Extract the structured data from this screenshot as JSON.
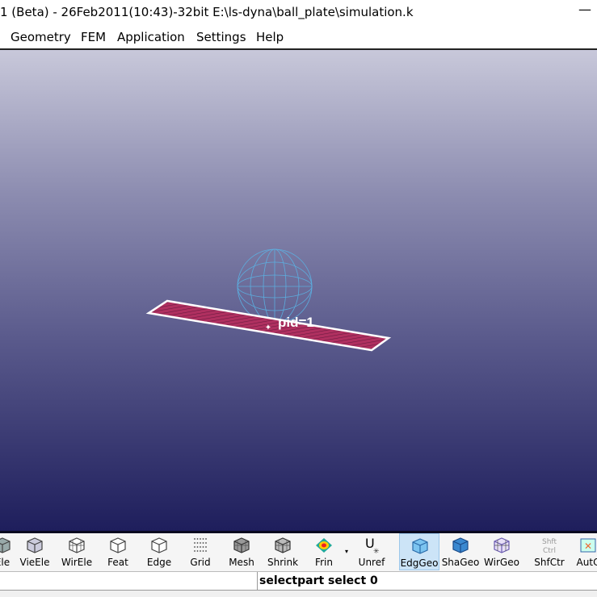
{
  "window": {
    "title": "1 (Beta) - 26Feb2011(10:43)-32bit E:\\ls-dyna\\ball_plate\\simulation.k",
    "minimize": "—"
  },
  "menu": [
    "Geometry",
    "FEM",
    "Application",
    "Settings",
    "Help"
  ],
  "viewport": {
    "part_label": "pid=1",
    "plate_color": "#b03060",
    "sphere_color": "#5ab4e6",
    "edge_color": "#ffffff"
  },
  "toolbar": {
    "items": [
      {
        "label": "Ele",
        "icon": "element-icon"
      },
      {
        "label": "VieEle",
        "icon": "view-element-icon"
      },
      {
        "label": "WirEle",
        "icon": "wire-element-icon"
      },
      {
        "label": "Feat",
        "icon": "feature-icon"
      },
      {
        "label": "Edge",
        "icon": "edge-icon"
      },
      {
        "label": "Grid",
        "icon": "grid-icon"
      },
      {
        "label": "Mesh",
        "icon": "mesh-icon"
      },
      {
        "label": "Shrink",
        "icon": "shrink-icon"
      },
      {
        "label": "Frin",
        "icon": "fringe-icon"
      },
      {
        "label": "Unref",
        "icon": "unref-icon"
      },
      {
        "label": "EdgGeo",
        "icon": "edge-geometry-icon",
        "active": true
      },
      {
        "label": "ShaGeo",
        "icon": "shaded-geometry-icon"
      },
      {
        "label": "WirGeo",
        "icon": "wire-geometry-icon"
      },
      {
        "label": "ShfCtr",
        "icon": "shift-ctrl-icon",
        "icon_text": [
          "Shft",
          "Ctrl"
        ]
      },
      {
        "label": "AutC",
        "icon": "auto-center-icon"
      }
    ],
    "unref_glyph": "U",
    "unref_sub": "✳"
  },
  "status": {
    "message": "selectpart select 0"
  }
}
